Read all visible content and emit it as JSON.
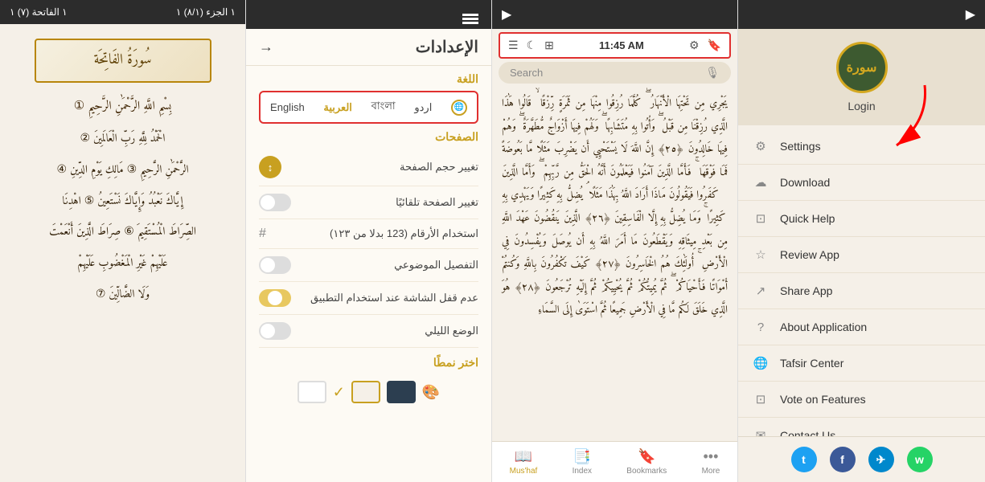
{
  "panel1": {
    "header": {
      "right": "١ الجزء (٨/١) ١",
      "left": "١ الفاتحة (٧) ١"
    },
    "surah_title": "سُورَةُ الفَاتِحَة",
    "bismillah": "بِسْمِ اللَّهِ الرَّحْمَٰنِ الرَّحِيمِ ①",
    "ayahs": [
      "الْحَمْدُ لِلَّهِ رَبِّ الْعَالَمِينَ ②",
      "الرَّحْمَٰنِ الرَّحِيمِ ③ مَالِكِ يَوْمِ الدِّينِ ④",
      "إِيَّاكَ نَعْبُدُ وَإِيَّاكَ نَسْتَعِينُ ⑤ اهْدِنَا",
      "الصِّرَاطَ الْمُسْتَقِيمَ ⑥ صِرَاطَ الَّذِينَ أَنْعَمْتَ",
      "عَلَيْهِمْ غَيْرِ الْمَغْضُوبِ عَلَيْهِمْ",
      "وَلَا الضَّالِّينَ ⑦"
    ]
  },
  "panel2": {
    "header": {},
    "title": "الإعدادات",
    "back_arrow": "→",
    "language_section_label": "اللغة",
    "languages": [
      "English",
      "العربية",
      "বাংলা",
      "اردو"
    ],
    "pages_section_label": "الصفحات",
    "settings": [
      {
        "label": "تغيير حجم الصفحة",
        "control": "arrow"
      },
      {
        "label": "تغيير الصفحة تلقائيًا",
        "control": "toggle_off"
      },
      {
        "label": "استخدام الأرقام (123 بدلا من ١٢٣)",
        "control": "toggle_off"
      },
      {
        "label": "التفصيل الموضوعي",
        "control": "toggle_off"
      },
      {
        "label": "عدم قفل الشاشة عند استخدام التطبيق",
        "control": "toggle_half"
      },
      {
        "label": "الوضع الليلي",
        "control": "toggle_off"
      }
    ],
    "theme_label": "اختر نمطًا",
    "themes": [
      "white",
      "#f5f0e8",
      "#2c3e50"
    ],
    "check_icon": "✓",
    "palette_icon": "🎨"
  },
  "panel3": {
    "time": "11:45 AM",
    "search_placeholder": "Search",
    "ayah_text": "يَجْرِي مِن تَحْتِهَا الْأَنْهَارُ ۖ كُلَّمَا رُزِقُوا مِنْهَا مِن ثَمَرَةٍ رِّزْقًا ۙ قَالُوا هَٰذَا الَّذِي رُزِقْنَا مِن قَبْلُ ۖ وَأُتُوا بِهِ مُتَشَابِهًا ۖ وَلَهُمْ فِيهَا أَزْوَاجٌ مُّطَهَّرَةٌ ۖ وَهُمْ فِيهَا خَالِدُونَ ﴿٢٥﴾ إِنَّ اللَّهَ لَا يَسْتَحْيِي أَن يَضْرِبَ مَثَلًا مَّا بَعُوضَةً فَمَا فَوْقَهَا ۚ فَأَمَّا الَّذِينَ آمَنُوا فَيَعْلَمُونَ أَنَّهُ الْحَقُّ مِن رَّبِّهِمْ ۖ وَأَمَّا الَّذِينَ كَفَرُوا فَيَقُولُونَ مَاذَا أَرَادَ اللَّهُ بِهَٰذَا مَثَلًا ۘ يُضِلُّ بِهِ كَثِيرًا وَيَهْدِي بِهِ كَثِيرًا ۚ وَمَا يُضِلُّ بِهِ إِلَّا الْفَاسِقِينَ ﴿٢٦﴾ الَّذِينَ يَنقُضُونَ عَهْدَ اللَّهِ مِن بَعْدِ مِيثَاقِهِ وَيَقْطَعُونَ مَا أَمَرَ اللَّهُ بِهِ أَن يُوصَلَ وَيُفْسِدُونَ فِي الْأَرْضِ ۚ أُولَٰئِكَ هُمُ الْخَاسِرُونَ ﴿٢٧﴾ كَيْفَ تَكْفُرُونَ بِاللَّهِ وَكُنتُمْ أَمْوَاتًا فَأَحْيَاكُمْ ۖ ثُمَّ يُمِيتُكُمْ ثُمَّ يُحْيِيكُمْ ثُمَّ إِلَيْهِ تُرْجَعُونَ ﴿٢٨﴾ هُوَ الَّذِي خَلَقَ لَكُم مَّا فِي الْأَرْضِ جَمِيعًا ثُمَّ اسْتَوَىٰ إِلَى السَّمَاءِ",
    "footer_tabs": [
      {
        "label": "Mus'haf",
        "icon": "📖",
        "active": true
      },
      {
        "label": "Index",
        "icon": "📑",
        "active": false
      },
      {
        "label": "Bookmarks",
        "icon": "🔖",
        "active": false
      },
      {
        "label": "More",
        "icon": "•••",
        "active": false
      }
    ]
  },
  "panel4": {
    "header": {},
    "logo_text": "سورة",
    "login_label": "Login",
    "menu_items": [
      {
        "id": "settings",
        "label": "Settings",
        "icon": "⚙"
      },
      {
        "id": "download",
        "label": "Download",
        "icon": "☁"
      },
      {
        "id": "quick-help",
        "label": "Quick Help",
        "icon": "⊡"
      },
      {
        "id": "review-app",
        "label": "Review App",
        "icon": "☆"
      },
      {
        "id": "share-app",
        "label": "Share App",
        "icon": "⟨⟩"
      },
      {
        "id": "about-application",
        "label": "About Application",
        "icon": "?"
      },
      {
        "id": "tafsir-center",
        "label": "Tafsir Center",
        "icon": "🌐"
      },
      {
        "id": "vote-on-features",
        "label": "Vote on Features",
        "icon": "⊡"
      },
      {
        "id": "contact-us",
        "label": "Contact Us",
        "icon": "✉"
      }
    ],
    "social": [
      {
        "id": "twitter",
        "label": "t",
        "color": "#1da1f2"
      },
      {
        "id": "facebook",
        "label": "f",
        "color": "#3b5998"
      },
      {
        "id": "telegram",
        "label": "✈",
        "color": "#0088cc"
      },
      {
        "id": "whatsapp",
        "label": "w",
        "color": "#25d366"
      }
    ]
  }
}
